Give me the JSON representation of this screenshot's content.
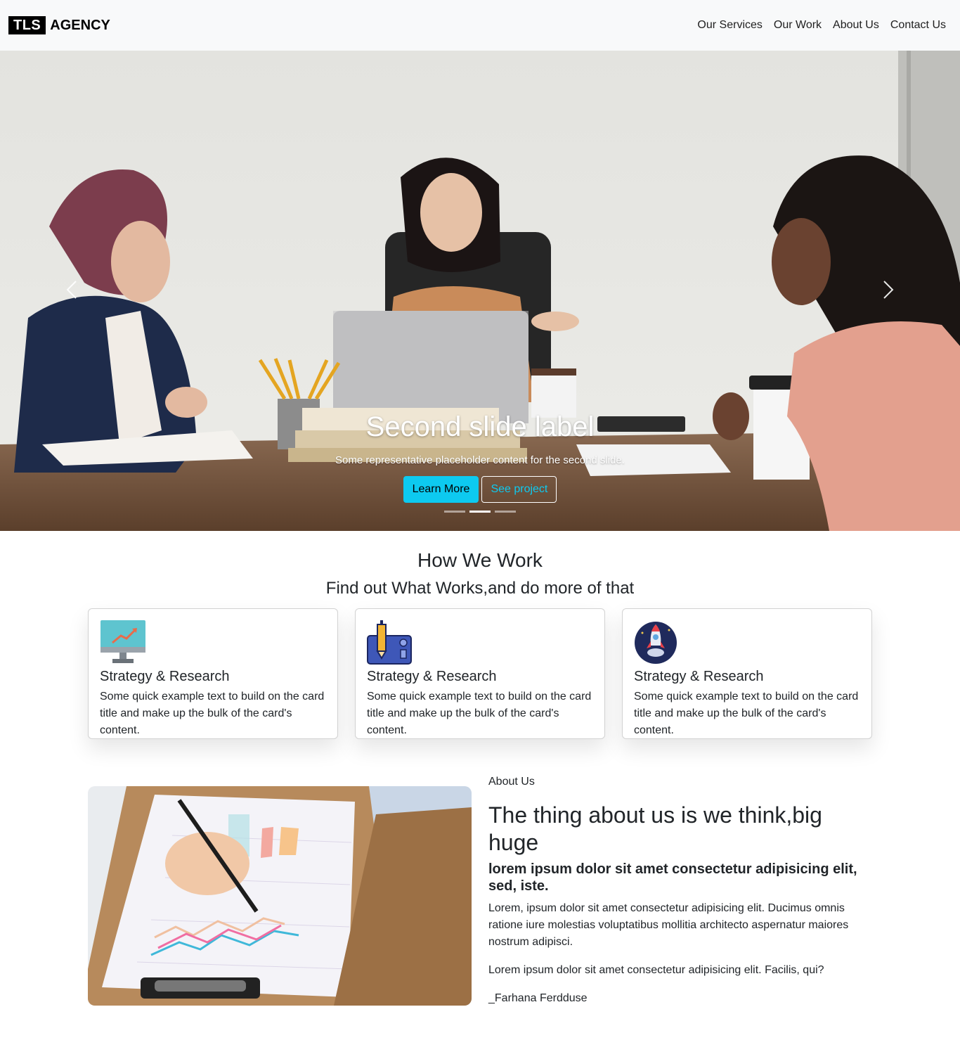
{
  "navbar": {
    "brand_box": "TLS",
    "brand_text": "AGENCY",
    "links": [
      "Our Services",
      "Our Work",
      "About Us",
      "Contact Us"
    ]
  },
  "hero": {
    "title": "Second slide label",
    "text": "Some representative placeholder content for the second slide.",
    "primary_button": "Learn More",
    "secondary_button": "See project",
    "indicators": 3,
    "active_indicator": 2
  },
  "how_we_work": {
    "title": "How We Work",
    "subtitle": "Find out What Works,and do more of that",
    "cards": [
      {
        "icon": "monitor-chart-icon",
        "title": "Strategy & Research",
        "text": "Some quick example text to build on the card title and make up the bulk of the card's content."
      },
      {
        "icon": "pencil-tablet-icon",
        "title": "Strategy & Research",
        "text": "Some quick example text to build on the card title and make up the bulk of the card's content."
      },
      {
        "icon": "rocket-icon",
        "title": "Strategy & Research",
        "text": "Some quick example text to build on the card title and make up the bulk of the card's content."
      }
    ]
  },
  "about": {
    "kicker": "About Us",
    "title": "The thing about us is we think,big huge",
    "lead": "lorem ipsum dolor sit amet consectetur adipisicing elit, sed, iste.",
    "paragraph1": "Lorem, ipsum dolor sit amet consectetur adipisicing elit. Ducimus omnis ratione iure molestias voluptatibus mollitia architecto aspernatur maiores nostrum adipisci.",
    "paragraph2": "Lorem ipsum dolor sit amet consectetur adipisicing elit. Facilis, qui?",
    "signature": "_Farhana Ferdduse"
  },
  "colors": {
    "accent": "#0dcaf0",
    "navbar_bg": "#f8f9fa",
    "text": "#212529"
  }
}
